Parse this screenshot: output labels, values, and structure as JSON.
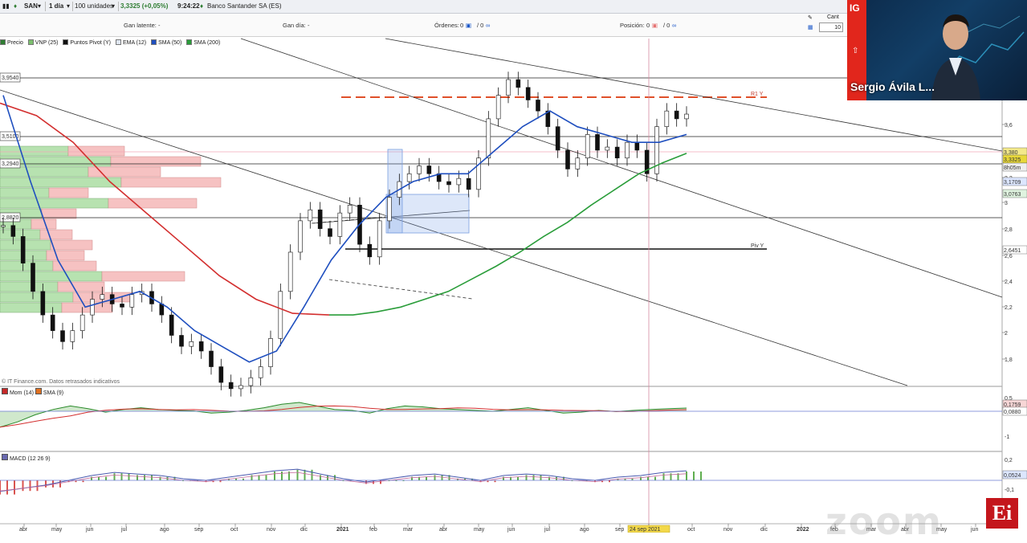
{
  "toolbar": {
    "symbol": "SAN",
    "interval": "1 día",
    "units": "100 unidades",
    "quote": "3,3325 (+0,05%)",
    "time": "9:24:22",
    "instrument": "Banco Santander SA (ES)"
  },
  "status": {
    "gan_latente_label": "Gan latente:",
    "gan_latente_value": "-",
    "gan_dia_label": "Gan día:",
    "gan_dia_value": "-",
    "ordenes_label": "Órdenes:",
    "ordenes_a": "0",
    "ordenes_b": "/ 0",
    "posicion_label": "Posición:",
    "posicion_a": "0",
    "posicion_b": "/ 0",
    "cant_label": "Cant",
    "cant_value": "10"
  },
  "legend": [
    {
      "label": "Precio",
      "color": "#2e7d32"
    },
    {
      "label": "VNP (25)",
      "color": "#7cbf6e"
    },
    {
      "label": "Puntos Pivot (Y)",
      "color": "#111111"
    },
    {
      "label": "EMA (12)",
      "color": "#dfe6f2"
    },
    {
      "label": "SMA (50)",
      "color": "#1f4fbf"
    },
    {
      "label": "SMA (200)",
      "color": "#2a9d3a"
    }
  ],
  "chart_data": [
    {
      "type": "candlestick",
      "name": "price",
      "y_ticks": [
        "3,6",
        "3,4",
        "3,2",
        "3",
        "2,8",
        "2,6",
        "2,4",
        "2,2",
        "2",
        "1,8"
      ],
      "x_ticks": [
        "abr",
        "may",
        "jun",
        "jul",
        "ago",
        "sep",
        "oct",
        "nov",
        "dic",
        "2021",
        "feb",
        "mar",
        "abr",
        "may",
        "jun",
        "jul",
        "ago",
        "sep",
        "24 sep 2021",
        "oct",
        "nov",
        "dic",
        "2022",
        "feb",
        "mar",
        "abr",
        "may",
        "jun"
      ],
      "ylim": [
        1.6,
        3.75
      ],
      "level_labels": [
        "3,9540",
        "3,5100",
        "3,2940",
        "2,8820"
      ],
      "levels": [
        3.954,
        3.51,
        3.294,
        2.882
      ],
      "pivot_labels": [
        {
          "text": "R1 Y",
          "value": 3.31
        },
        {
          "text": "Piv Y",
          "value": 2.645
        }
      ],
      "price_tags": [
        {
          "text": "3,380",
          "bg": "#f3e98a"
        },
        {
          "text": "3,3325",
          "bg": "#e8d83a"
        },
        {
          "text": "8h05m",
          "bg": "#eeeeee"
        },
        {
          "text": "3,1709",
          "bg": "#dce6ff"
        },
        {
          "text": "3,0763",
          "bg": "#dff3df"
        },
        {
          "text": "2,6451",
          "bg": "#ffffff"
        }
      ],
      "series": [
        {
          "name": "SMA (50)",
          "color": "#1f4fbf",
          "values": [
            3.45,
            2.9,
            2.4,
            2.1,
            2.15,
            2.2,
            2.1,
            1.95,
            1.85,
            1.75,
            1.82,
            2.1,
            2.4,
            2.62,
            2.8,
            2.9,
            2.95,
            2.95,
            3.1,
            3.25,
            3.35,
            3.25,
            3.2,
            3.15,
            3.15,
            3.2
          ]
        },
        {
          "name": "SMA (200)",
          "color": "#2a9d3a",
          "values": [
            2.05,
            2.05,
            2.07,
            2.1,
            2.15,
            2.2,
            2.28,
            2.36,
            2.45,
            2.55,
            2.64,
            2.75,
            2.85,
            2.95,
            3.02,
            3.08
          ]
        },
        {
          "name": "red MA",
          "color": "#d32f2f",
          "values": [
            3.4,
            3.32,
            3.15,
            2.9,
            2.7,
            2.5,
            2.3,
            2.15,
            2.06,
            2.05
          ]
        }
      ],
      "closes": [
        2.62,
        2.55,
        2.38,
        2.2,
        2.05,
        1.95,
        1.88,
        1.95,
        2.05,
        2.15,
        2.18,
        2.12,
        2.1,
        2.18,
        2.2,
        2.12,
        2.05,
        1.92,
        1.85,
        1.88,
        1.82,
        1.72,
        1.62,
        1.58,
        1.6,
        1.65,
        1.72,
        1.9,
        2.2,
        2.45,
        2.65,
        2.72,
        2.6,
        2.55,
        2.7,
        2.75,
        2.5,
        2.42,
        2.65,
        2.8,
        2.9,
        2.95,
        3.0,
        2.95,
        2.9,
        2.88,
        2.92,
        2.85,
        3.05,
        3.3,
        3.45,
        3.55,
        3.5,
        3.42,
        3.35,
        3.25,
        3.1,
        2.98,
        3.05,
        3.2,
        3.1,
        3.12,
        3.05,
        3.15,
        3.1,
        2.95,
        3.25,
        3.35,
        3.3,
        3.33
      ]
    },
    {
      "type": "area",
      "name": "Mom (14)",
      "legend": [
        "Mom (14)",
        "SMA (9)"
      ],
      "y_ticks": [
        "0,5",
        "0",
        "-1"
      ],
      "tags": [
        "0,1759",
        "0,0880"
      ],
      "values": [
        -0.9,
        -0.6,
        -0.2,
        0.1,
        0.3,
        0.15,
        -0.05,
        0.1,
        0.2,
        0.1,
        0.05,
        0.02,
        -0.1,
        -0.05,
        0.05,
        0.2,
        0.4,
        0.5,
        0.3,
        0.1,
        0.05,
        -0.1,
        0.15,
        0.3,
        0.25,
        0.15,
        0.1,
        0.05,
        0.0,
        0.1,
        0.2,
        0.05,
        -0.1,
        -0.05,
        0.05,
        -0.02,
        0.05,
        0.1,
        0.15,
        0.18
      ]
    },
    {
      "type": "bar",
      "name": "MACD (12 26 9)",
      "legend": [
        "MACD (12 26 9)"
      ],
      "y_ticks": [
        "0,2",
        "-0,1"
      ],
      "tags": [
        "0,0524"
      ],
      "values": [
        -0.08,
        -0.06,
        -0.04,
        -0.01,
        0.02,
        0.04,
        0.03,
        0.02,
        0.0,
        -0.01,
        0.01,
        0.03,
        0.05,
        0.06,
        0.03,
        0.0,
        -0.02,
        0.0,
        0.02,
        0.03,
        0.01,
        -0.01,
        0.02,
        0.03,
        0.02,
        0.0,
        -0.01,
        0.01,
        0.02,
        0.04,
        0.05
      ]
    }
  ],
  "footer": {
    "source": "© IT Finance.com. Datos retrasados indicativos",
    "zoom": "zoom",
    "ei": "Ei"
  },
  "video": {
    "brand": "IG",
    "name": "Sergio Ávila L..."
  }
}
